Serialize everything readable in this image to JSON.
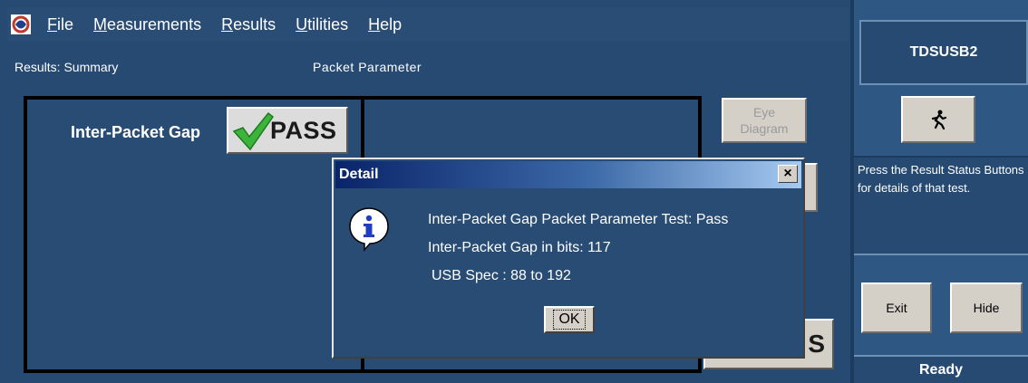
{
  "menu": {
    "items": [
      "File",
      "Measurements",
      "Results",
      "Utilities",
      "Help"
    ]
  },
  "labels": {
    "results_summary": "Results: Summary",
    "packet_parameter": "Packet Parameter",
    "inter_packet_gap": "Inter-Packet Gap",
    "pass": "PASS",
    "pass_partial": "S"
  },
  "buttons": {
    "eye_diagram_line1": "Eye",
    "eye_diagram_line2": "Diagram",
    "exit": "Exit",
    "hide": "Hide"
  },
  "side": {
    "title": "TDSUSB2",
    "info": "Press the Result Status Buttons for details of that test.",
    "status": "Ready"
  },
  "dialog": {
    "title": "Detail",
    "close": "×",
    "line1": "Inter-Packet Gap Packet Parameter Test: Pass",
    "line2": "Inter-Packet Gap in bits: 117",
    "line3": "USB Spec : 88 to  192",
    "ok": "OK"
  },
  "colors": {
    "background": "#274a72",
    "button": "#d4d0c8",
    "check_green": "#3cb43c"
  },
  "icons": [
    "app-icon",
    "check-icon",
    "run-icon",
    "info-icon"
  ]
}
